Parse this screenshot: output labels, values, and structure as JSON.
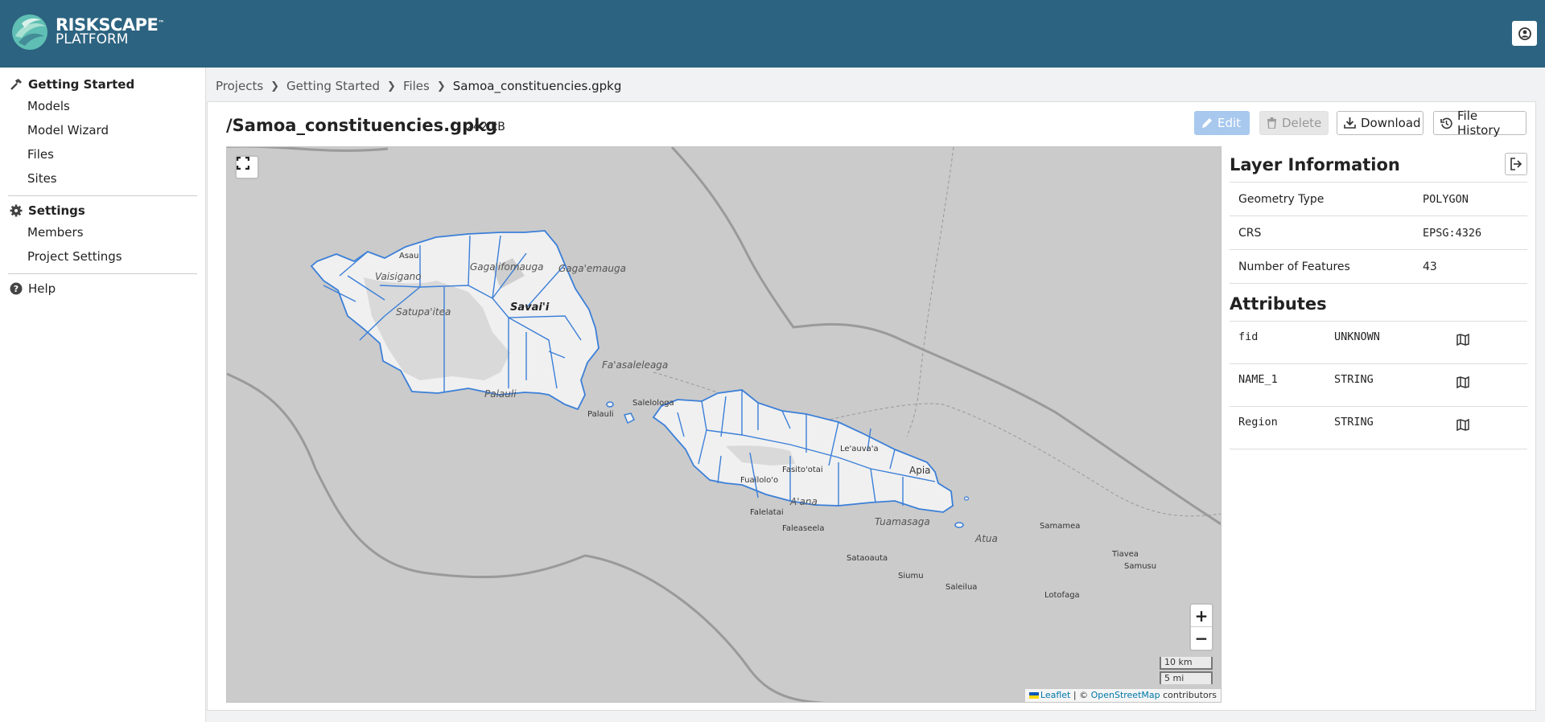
{
  "header": {
    "logo_line1": "RISKSCAPE",
    "logo_tm": "™",
    "logo_line2": "PLATFORM",
    "user_icon": "user-circle-icon"
  },
  "sidebar": {
    "sections": [
      {
        "label": "Getting Started",
        "icon": "hammer-icon",
        "items": [
          "Models",
          "Model Wizard",
          "Files",
          "Sites"
        ]
      },
      {
        "label": "Settings",
        "icon": "gear-icon",
        "items": [
          "Members",
          "Project Settings"
        ]
      },
      {
        "label": "Help",
        "icon": "question-circle-icon",
        "items": []
      }
    ]
  },
  "breadcrumb": [
    "Projects",
    "Getting Started",
    "Files",
    "Samoa_constituencies.gpkg"
  ],
  "file": {
    "title": "/Samoa_constituencies.gpkg",
    "size": "242 kB"
  },
  "toolbar": {
    "edit": "Edit",
    "delete": "Delete",
    "download": "Download",
    "history": "File History"
  },
  "map": {
    "zoom_in": "+",
    "zoom_out": "−",
    "scale_km": "10 km",
    "scale_mi": "5 mi",
    "attribution_leaflet": "Leaflet",
    "attribution_sep": " | © ",
    "attribution_osm": "OpenStreetMap",
    "attribution_tail": " contributors",
    "labels": {
      "savaii": "Savai'i",
      "gagaifomauga": "Gaga'ifomauga",
      "gagaemauga": "Gaga'emauga",
      "vaisigano": "Vaisigano",
      "satupaitea": "Satupa'itea",
      "palauli_region": "Palauli",
      "faasaleleaga": "Fa'asaleleaga",
      "asau": "Asau",
      "salelologa": "Salelologa",
      "palauli": "Palauli",
      "apia": "Apia",
      "leauvaa": "Le'auva'a",
      "fasitootai": "Fasito'otai",
      "fualoloo": "Fuailolo'o",
      "aana": "A'ana",
      "falelatai": "Falelatai",
      "faleaseela": "Faleaseela",
      "tuamasaga": "Tuamasaga",
      "satoalepai": "Sataoauta",
      "siumu": "Siumu",
      "atua": "Atua",
      "salelua": "Saleilua",
      "lotofaga": "Lotofaga",
      "samamea": "Samamea",
      "tiavea": "Tiavea",
      "samusu": "Samusu"
    }
  },
  "layer_info": {
    "title": "Layer Information",
    "rows": [
      {
        "label": "Geometry Type",
        "value": "POLYGON"
      },
      {
        "label": "CRS",
        "value": "EPSG:4326"
      },
      {
        "label": "Number of Features",
        "value": "43"
      }
    ]
  },
  "attributes": {
    "title": "Attributes",
    "rows": [
      {
        "name": "fid",
        "type": "UNKNOWN",
        "icon": "map-icon"
      },
      {
        "name": "NAME_1",
        "type": "STRING",
        "icon": "map-icon"
      },
      {
        "name": "Region",
        "type": "STRING",
        "icon": "map-icon"
      }
    ]
  }
}
